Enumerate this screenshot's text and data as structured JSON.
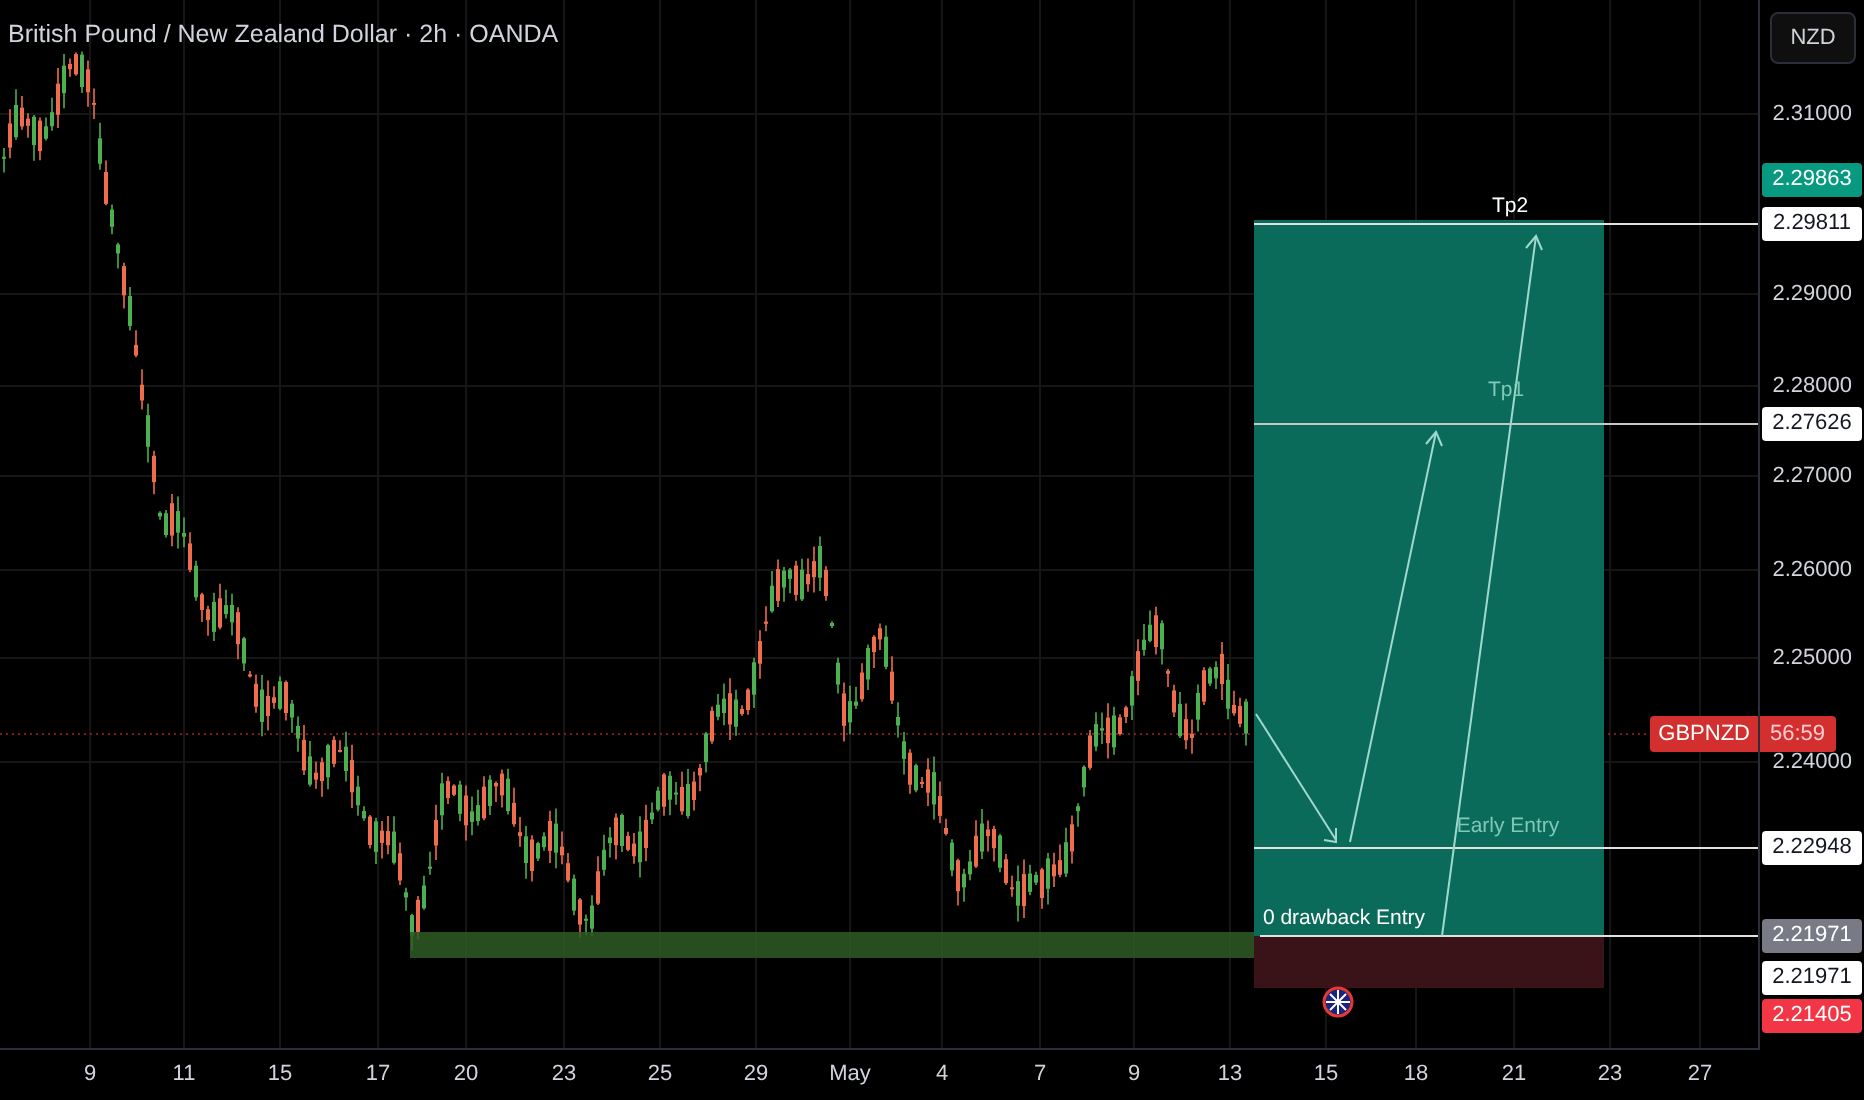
{
  "chart": {
    "title": "British Pound / New Zealand Dollar · 2h · OANDA",
    "annotations": [
      {
        "kind": "label",
        "text": "Tp2"
      },
      {
        "kind": "label",
        "text": "Tp1"
      },
      {
        "kind": "label",
        "text": "Early Entry"
      },
      {
        "kind": "label",
        "text": "0 drawback Entry"
      }
    ]
  },
  "price_axis": {
    "currency": "NZD",
    "ticks": [
      "2.31000",
      "2.29000",
      "2.28000",
      "2.27000",
      "2.26000",
      "2.25000",
      "2.24000"
    ],
    "tags": [
      {
        "text": "2.29863",
        "color": "#089981"
      },
      {
        "text": "2.29811",
        "color": "#ffffff"
      },
      {
        "text": "2.27626",
        "color": "#ffffff"
      },
      {
        "text": "2.22948",
        "color": "#ffffff"
      },
      {
        "text": "2.21971",
        "color": "#787b86"
      },
      {
        "text": "2.21971",
        "color": "#ffffff"
      },
      {
        "text": "2.21405",
        "color": "#f23645"
      }
    ]
  },
  "symbol_tag": {
    "symbol": "GBPNZD",
    "countdown": "56:59"
  },
  "time_axis": {
    "labels": [
      "9",
      "11",
      "15",
      "17",
      "20",
      "23",
      "25",
      "29",
      "May",
      "4",
      "7",
      "9",
      "13",
      "15",
      "18",
      "21",
      "23",
      "27"
    ]
  }
}
